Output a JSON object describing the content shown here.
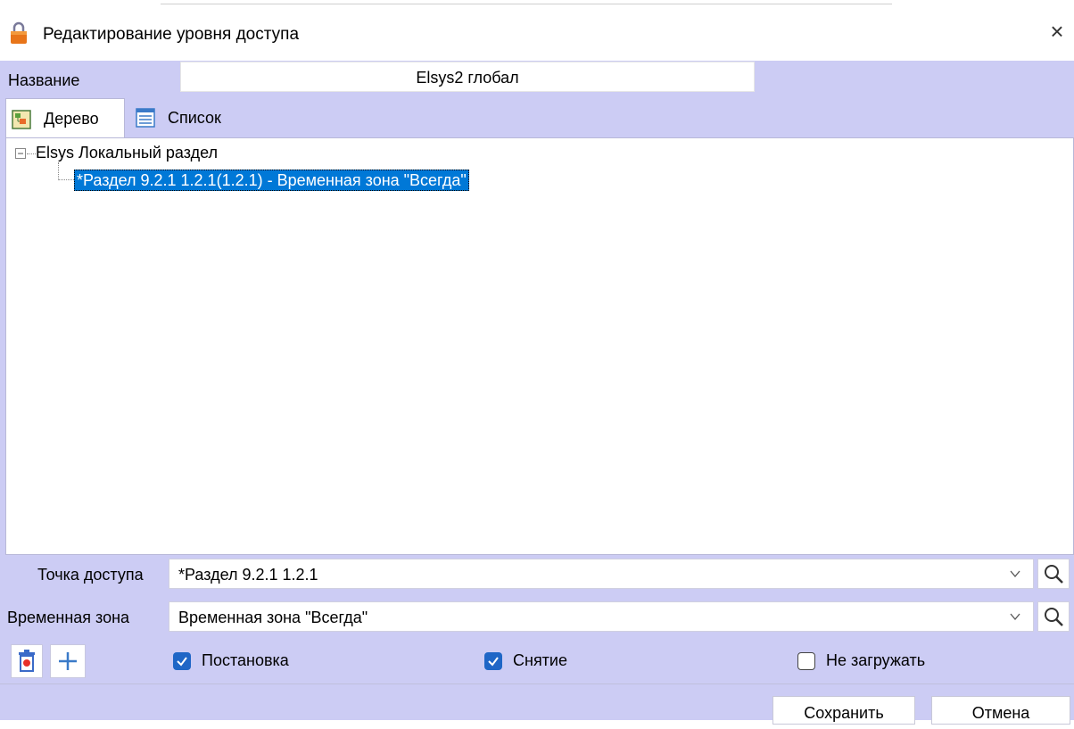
{
  "window": {
    "title": "Редактирование уровня доступа",
    "close_label": "×"
  },
  "name_row": {
    "label": "Название",
    "value": "Elsys2 глобал"
  },
  "tabs": [
    {
      "label": "Дерево",
      "icon": "tree-tab-icon",
      "active": true
    },
    {
      "label": "Список",
      "icon": "list-tab-icon",
      "active": false
    }
  ],
  "tree": {
    "root_label": "Elsys Локальный раздел",
    "toggle": "−",
    "children": [
      {
        "label": "*Раздел 9.2.1 1.2.1(1.2.1) - Временная зона \"Всегда\"",
        "selected": true
      }
    ]
  },
  "access_point": {
    "label": "Точка доступа",
    "value": "*Раздел 9.2.1 1.2.1"
  },
  "time_zone": {
    "label": "Временная зона",
    "value": "Временная зона \"Всегда\""
  },
  "toolbar": {
    "delete_icon": "trash-icon",
    "add_icon": "plus-icon"
  },
  "checkboxes": [
    {
      "label": "Постановка",
      "checked": true
    },
    {
      "label": "Снятие",
      "checked": true
    },
    {
      "label": "Не загружать",
      "checked": false
    }
  ],
  "footer": {
    "save_label": "Сохранить",
    "cancel_label": "Отмена"
  },
  "colors": {
    "panel_bg": "#ccccf4",
    "selection": "#0078d7",
    "checkbox_checked": "#1f66c6"
  }
}
